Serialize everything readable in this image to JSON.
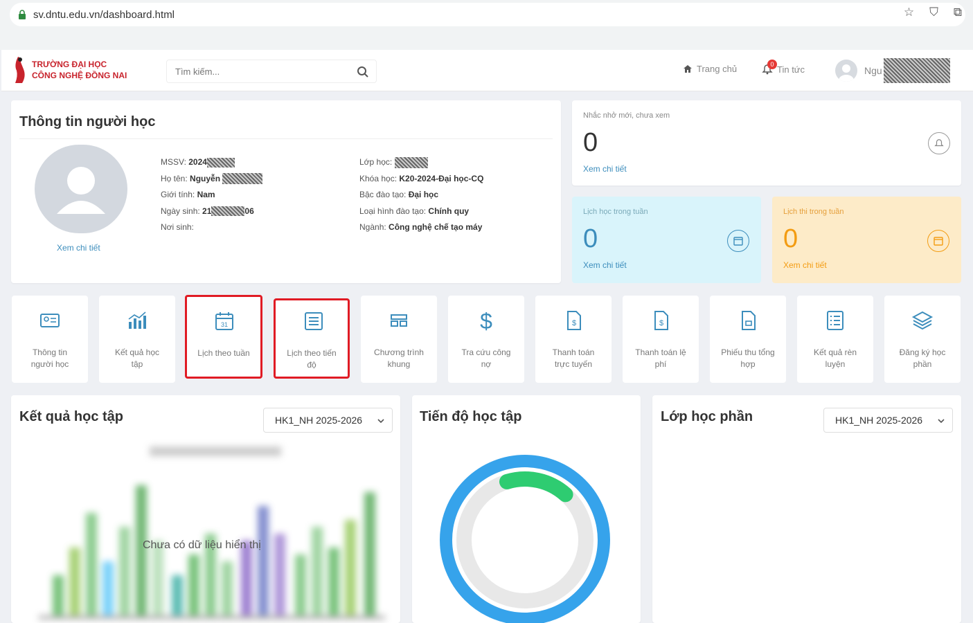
{
  "browser": {
    "url": "sv.dntu.edu.vn/dashboard.html"
  },
  "header": {
    "logo_line1": "TRƯỜNG ĐẠI HỌC",
    "logo_line2": "CÔNG NGHỆ ĐỒNG NAI",
    "search_placeholder": "Tìm kiếm...",
    "home_label": "Trang chủ",
    "news_label": "Tin tức",
    "news_badge": "0",
    "user_name": "Ngu"
  },
  "student_info": {
    "title": "Thông tin người học",
    "view_detail": "Xem chi tiết",
    "col1": [
      {
        "label": "MSSV: ",
        "value": "2024"
      },
      {
        "label": "Họ tên: ",
        "value": "Nguyễn"
      },
      {
        "label": "Giới tính: ",
        "value": "Nam"
      },
      {
        "label": "Ngày sinh: ",
        "value": "21",
        "value_suffix": "06"
      },
      {
        "label": "Nơi sinh:",
        "value": ""
      }
    ],
    "col2": [
      {
        "label": "Lớp học: ",
        "value": ""
      },
      {
        "label": "Khóa học: ",
        "value": "K20-2024-Đại học-CQ"
      },
      {
        "label": "Bậc đào tạo: ",
        "value": "Đại học"
      },
      {
        "label": "Loại hình đào tạo: ",
        "value": "Chính quy"
      },
      {
        "label": "Ngành: ",
        "value": "Công nghệ chế tạo máy"
      }
    ]
  },
  "reminder": {
    "label": "Nhắc nhở mới, chưa xem",
    "value": "0",
    "link": "Xem chi tiết"
  },
  "weekly": {
    "label": "Lịch học trong tuần",
    "value": "0",
    "link": "Xem chi tiết"
  },
  "exam": {
    "label": "Lịch thi trong tuần",
    "value": "0",
    "link": "Xem chi tiết"
  },
  "tiles": [
    {
      "line1": "Thông tin",
      "line2": "người học",
      "icon": "id-card-icon"
    },
    {
      "line1": "Kết quả học",
      "line2": "tập",
      "icon": "bar-chart-icon"
    },
    {
      "line1": "Lịch theo tuần",
      "line2": "",
      "icon": "calendar-icon"
    },
    {
      "line1": "Lịch theo tiến",
      "line2": "độ",
      "icon": "list-icon"
    },
    {
      "line1": "Chương trình",
      "line2": "khung",
      "icon": "grid-icon"
    },
    {
      "line1": "Tra cứu công",
      "line2": "nợ",
      "icon": "dollar-icon"
    },
    {
      "line1": "Thanh toán",
      "line2": "trực tuyến",
      "icon": "invoice-icon"
    },
    {
      "line1": "Thanh toán lệ",
      "line2": "phí",
      "icon": "invoice-icon"
    },
    {
      "line1": "Phiếu thu tổng",
      "line2": "hợp",
      "icon": "receipt-icon"
    },
    {
      "line1": "Kết quả rèn",
      "line2": "luyện",
      "icon": "checklist-icon"
    },
    {
      "line1": "Đăng ký học",
      "line2": "phần",
      "icon": "layers-icon"
    }
  ],
  "results": {
    "title": "Kết quả học tập",
    "semester": "HK1_NH 2025-2026",
    "empty_message": "Chưa có dữ liệu hiển thị"
  },
  "progress": {
    "title": "Tiến độ học tập",
    "fraction": 0.1
  },
  "sections": {
    "title": "Lớp học phần",
    "semester": "HK1_NH 2025-2026"
  },
  "colors": {
    "accent": "#3c8dbc",
    "highlight": "#e01b24",
    "ring": "#36a3eb",
    "ring_progress": "#2ecc71"
  }
}
